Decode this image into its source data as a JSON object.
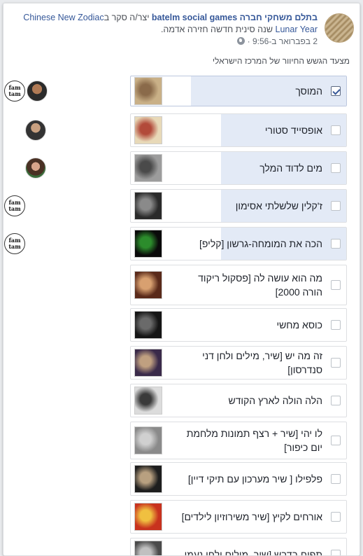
{
  "post": {
    "page_name": "בתלם משחקי חברה batelm social games",
    "action_text": " יצר/ה סקר ב",
    "group_name": "Chinese New Zodiac",
    "line2_link": "Lunar Year",
    "line2_text": " שנה סינית חדשה חזירה אדמה.",
    "timestamp": "2 בפברואר ב-9:56",
    "separator": " · "
  },
  "poll": {
    "question": "מצעד הגשש החיוור של המרכז הישראלי",
    "options": [
      {
        "label": "המוסך",
        "checked": true,
        "fill": 0.72,
        "voters": [
          "famtam-avatar",
          "man-avatar"
        ]
      },
      {
        "label": "אופסייד סטורי",
        "checked": false,
        "fill": 0.58,
        "voters": [
          "man-avatar"
        ]
      },
      {
        "label": "מים לדוד המלך",
        "checked": false,
        "fill": 0.58,
        "voters": [
          "woman-avatar"
        ]
      },
      {
        "label": "ז'קלין שלשלתי אסימון",
        "checked": false,
        "fill": 0.58,
        "voters": [
          "famtam-avatar"
        ]
      },
      {
        "label": "הכה את המומחה-גרשון [קליפ]",
        "checked": false,
        "fill": 0.58,
        "voters": [
          "famtam-avatar"
        ]
      },
      {
        "label": "מה הוא עושה לה [פסקול ריקוד הורה 2000]",
        "checked": false,
        "fill": 0,
        "voters": []
      },
      {
        "label": "כוסא מחשי",
        "checked": false,
        "fill": 0,
        "voters": []
      },
      {
        "label": "זה מה יש [שיר, מילים ולחן דני סנדרסון]",
        "checked": false,
        "fill": 0,
        "voters": []
      },
      {
        "label": "הלה הולה לארץ הקודש",
        "checked": false,
        "fill": 0,
        "voters": []
      },
      {
        "label": "לו יהי [שיר + רצף תמונות מלחמת יום כיפור]",
        "checked": false,
        "fill": 0,
        "voters": []
      },
      {
        "label": "פלפילו [ שיר מערכון עם תיקי דיין]",
        "checked": false,
        "fill": 0,
        "voters": []
      },
      {
        "label": "אורחים לקיץ [שיר משירוזיון לילדים]",
        "checked": false,
        "fill": 0,
        "voters": []
      },
      {
        "label": "תפוח בדבש [שיר, מילים ולחן נעמי",
        "checked": false,
        "fill": 0,
        "voters": []
      }
    ],
    "famtam_text": "fam tam"
  },
  "colors": {
    "link": "#365899",
    "bar_fill": "#e3eaf6",
    "border": "#dddfe2"
  }
}
